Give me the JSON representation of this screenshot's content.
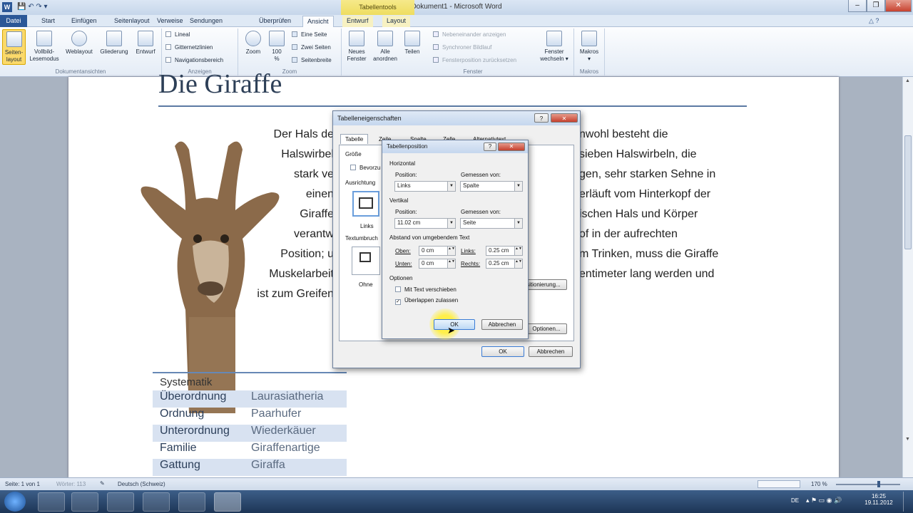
{
  "window": {
    "title": "Dokument1 - Microsoft Word",
    "context_tab_group": "Tabellentools"
  },
  "tabs": [
    "Datei",
    "Start",
    "Einfügen",
    "Seitenlayout",
    "Verweise",
    "Sendungen",
    "Überprüfen",
    "Ansicht",
    "Entwurf",
    "Layout"
  ],
  "ribbon": {
    "groups": {
      "dokumentansichten": "Dokumentansichten",
      "anzeigen": "Anzeigen",
      "zoom": "Zoom",
      "fenster": "Fenster",
      "makros": "Makros"
    },
    "views": [
      "Seiten-\nlayout",
      "Vollbild-\nLesemodus",
      "Weblayout",
      "Gliederung",
      "Entwurf"
    ],
    "show": [
      "Lineal",
      "Gitternetzlinien",
      "Navigationsbereich"
    ],
    "zoom_btn": "Zoom",
    "zoom_100": "100\n%",
    "zoom_pages": [
      "Eine Seite",
      "Zwei Seiten",
      "Seitenbreite"
    ],
    "window_btns": [
      "Neues\nFenster",
      "Alle\nanordnen",
      "Teilen"
    ],
    "window_small": [
      "Nebeneinander anzeigen",
      "Synchroner Bildlauf",
      "Fensterposition zurücksetzen"
    ],
    "switch_windows": "Fenster\nwechseln ▾",
    "macros": "Makros\n▾"
  },
  "document": {
    "title": "Die Giraffe",
    "para_left": [
      "Der Hals de",
      "Halswirbel",
      "stark ve",
      "einen",
      "Giraffe",
      "verantw",
      "Position; u",
      "Muskelarbeit",
      "ist zum Greifen"
    ],
    "para_right": [
      "nwohl besteht die",
      "sieben Halswirbeln, die",
      "gen, sehr starken Sehne in",
      "erläuft vom Hinterkopf der",
      "ischen Hals und Körper",
      "of in der aufrechten",
      "m Trinken, muss die Giraffe",
      "entimeter lang werden und"
    ],
    "systematik": {
      "header": "Systematik",
      "rows": [
        [
          "Überordnung",
          "Laurasiatheria"
        ],
        [
          "Ordnung",
          "Paarhufer"
        ],
        [
          "Unterordnung",
          "Wiederkäuer"
        ],
        [
          "Familie",
          "Giraffenartige"
        ],
        [
          "Gattung",
          "Giraffa"
        ]
      ]
    }
  },
  "dialog_outer": {
    "title": "Tabelleneigenschaften",
    "tabs": [
      "Tabelle",
      "Zeile",
      "Spalte",
      "Zelle",
      "Alternativtext"
    ],
    "groesse": "Größe",
    "bevorzugt": "Bevorzu",
    "ausrichtung": "Ausrichtung",
    "links": "Links",
    "textumbruch": "Textumbruch",
    "ohne": "Ohne",
    "positionierung_btn": "Positionierung...",
    "optionen_btn": "Optionen...",
    "ok": "OK",
    "cancel": "Abbrechen"
  },
  "dialog_inner": {
    "title": "Tabellenposition",
    "horizontal": "Horizontal",
    "position_label": "Position:",
    "measured_label": "Gemessen von:",
    "h_position": "Links",
    "h_measured": "Spalte",
    "vertikal": "Vertikal",
    "v_position": "11.02 cm",
    "v_measured": "Seite",
    "distance": "Abstand von umgebendem Text",
    "oben": "Oben:",
    "unten": "Unten:",
    "links": "Links:",
    "rechts": "Rechts:",
    "oben_val": "0 cm",
    "unten_val": "0 cm",
    "links_val": "0.25 cm",
    "rechts_val": "0.25 cm",
    "optionen": "Optionen",
    "move_with_text": "Mit Text verschieben",
    "allow_overlap": "Überlappen zulassen",
    "ok": "OK",
    "cancel": "Abbrechen"
  },
  "status": {
    "page": "Seite: 1 von 1",
    "words": "Wörter: 113",
    "language": "Deutsch (Schweiz)",
    "zoom": "170 %"
  },
  "taskbar": {
    "lang": "DE",
    "time": "16:25",
    "date": "19.11.2012"
  }
}
